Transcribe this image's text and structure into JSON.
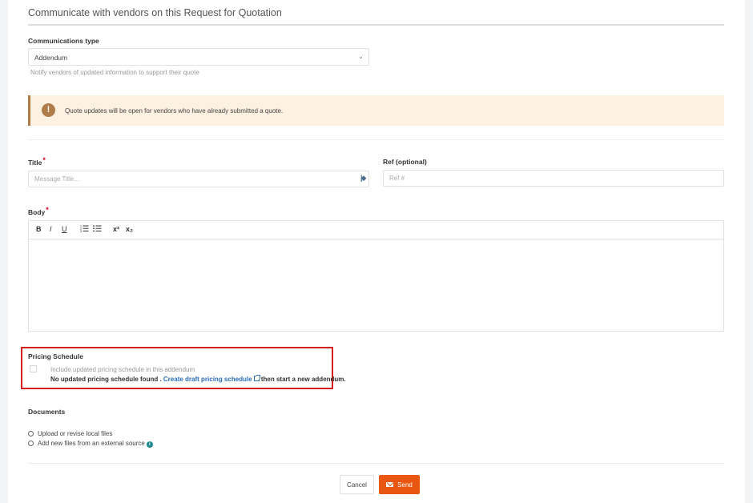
{
  "page": {
    "title": "Communicate with vendors on this Request for Quotation"
  },
  "communications_type": {
    "label": "Communications type",
    "value": "Addendum",
    "helper": "Notify vendors of updated information to support their quote"
  },
  "alert": {
    "icon": "exclamation-icon",
    "text": "Quote updates will be open for vendors who have already submitted a quote."
  },
  "title_field": {
    "label": "Title",
    "required_mark": "*",
    "placeholder": "Message Title..."
  },
  "ref_field": {
    "label": "Ref (optional)",
    "placeholder": "Ref #"
  },
  "body_field": {
    "label": "Body",
    "required_mark": "*",
    "toolbar": {
      "bold": "B",
      "italic": "I",
      "underline": "U",
      "superscript": "x²",
      "subscript": "x₂"
    }
  },
  "pricing_schedule": {
    "label": "Pricing Schedule",
    "checkbox_label": "Include updated pricing schedule in this addendum",
    "not_found_text": "No updated pricing schedule found .",
    "link_text": "Create draft pricing schedule",
    "after_link_text": "then start a new addendum."
  },
  "documents": {
    "label": "Documents",
    "options": [
      "Upload or revise local files",
      "Add new files from an external source"
    ]
  },
  "actions": {
    "cancel_label": "Cancel",
    "send_label": "Send"
  },
  "colors": {
    "send_button": "#e8560f",
    "alert_bg": "#fdf1e2",
    "alert_accent": "#b07c48",
    "link": "#2a6eb8",
    "highlight_border": "#d71f1f"
  }
}
